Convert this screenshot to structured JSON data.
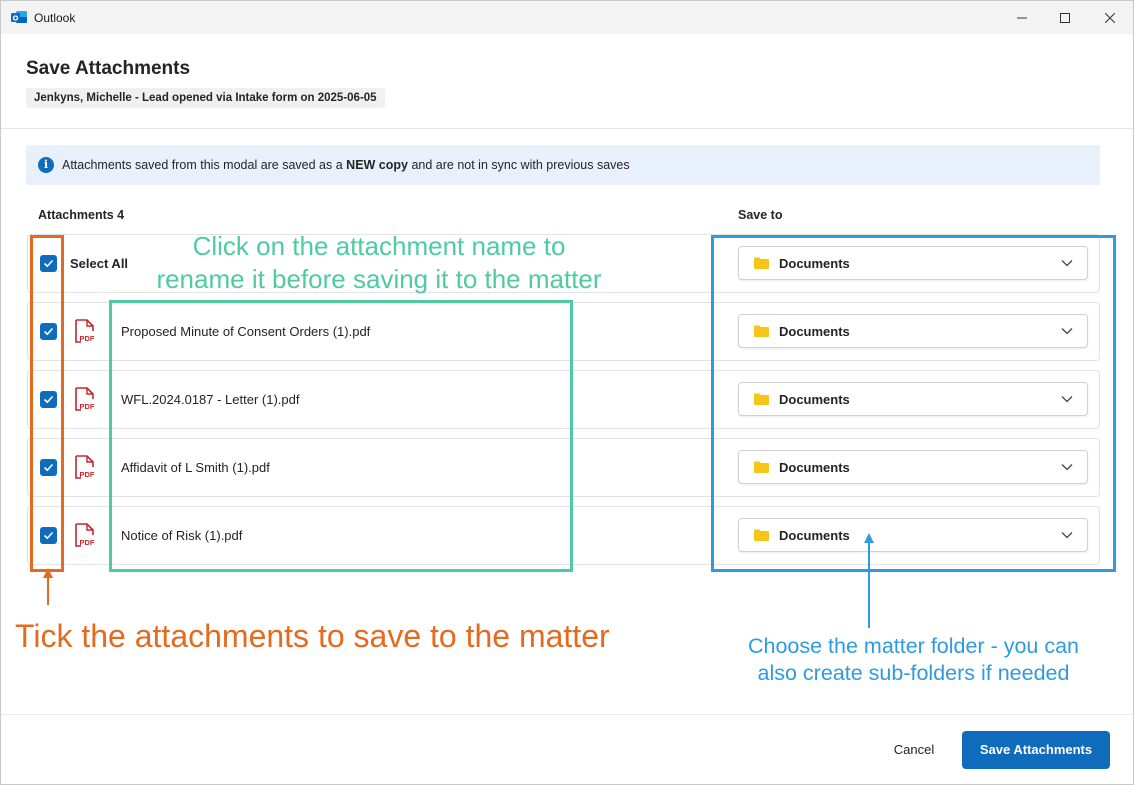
{
  "window": {
    "app_title": "Outlook",
    "logo_icon": "outlook-logo-icon",
    "controls": [
      "minimize-icon",
      "maximize-icon",
      "close-icon"
    ]
  },
  "dialog": {
    "title": "Save Attachments",
    "subject": "Jenkyns, Michelle - Lead opened via Intake form on 2025-06-05"
  },
  "info": {
    "icon": "info-icon",
    "text_before": "Attachments saved from this modal are saved as a ",
    "text_bold": "NEW copy",
    "text_after": " and are not in sync with previous saves"
  },
  "columns": {
    "attachments": "Attachments 4",
    "save_to": "Save to"
  },
  "select_all": {
    "label": "Select All",
    "checked": true,
    "folder": "Documents"
  },
  "attachments": [
    {
      "name": "Proposed Minute of Consent Orders (1).pdf",
      "type": "pdf",
      "checked": true,
      "folder": "Documents"
    },
    {
      "name": "WFL.2024.0187 - Letter (1).pdf",
      "type": "pdf",
      "checked": true,
      "folder": "Documents"
    },
    {
      "name": "Affidavit of L Smith (1).pdf",
      "type": "pdf",
      "checked": true,
      "folder": "Documents"
    },
    {
      "name": "Notice of Risk (1).pdf",
      "type": "pdf",
      "checked": true,
      "folder": "Documents"
    }
  ],
  "annotations": {
    "rename_hint_line1": "Click on the attachment name to",
    "rename_hint_line2": "rename it before saving it to the matter",
    "tick_hint": "Tick the attachments to save to the matter",
    "folder_hint_line1": "Choose the matter folder - you can",
    "folder_hint_line2": "also create sub-folders if needed"
  },
  "footer": {
    "cancel_label": "Cancel",
    "save_label": "Save Attachments"
  },
  "colors": {
    "accent": "#0f6cbd",
    "annotation_orange": "#e36b1f",
    "annotation_green": "#4ecba0",
    "annotation_blue": "#2e9be0",
    "pdf_red": "#c4262e",
    "folder_yellow": "#f5c518"
  }
}
